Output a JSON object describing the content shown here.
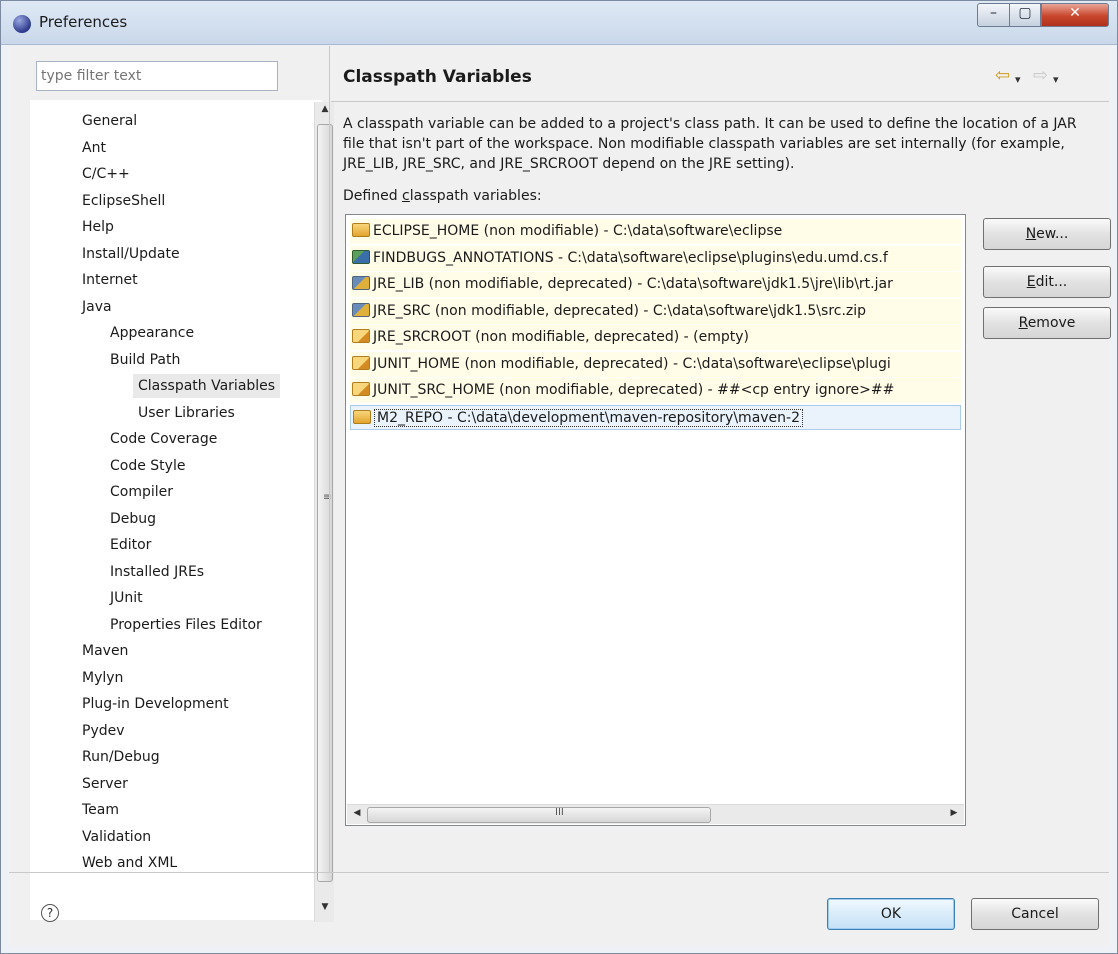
{
  "window": {
    "title": "Preferences",
    "controls": {
      "minimize": "–",
      "maximize": "▢",
      "close": "✕"
    }
  },
  "sidebar": {
    "filter_placeholder": "type filter text",
    "items": [
      {
        "label": "General",
        "level": 0
      },
      {
        "label": "Ant",
        "level": 0
      },
      {
        "label": "C/C++",
        "level": 0
      },
      {
        "label": "EclipseShell",
        "level": 0
      },
      {
        "label": "Help",
        "level": 0
      },
      {
        "label": "Install/Update",
        "level": 0
      },
      {
        "label": "Internet",
        "level": 0
      },
      {
        "label": "Java",
        "level": 0
      },
      {
        "label": "Appearance",
        "level": 1
      },
      {
        "label": "Build Path",
        "level": 1
      },
      {
        "label": "Classpath Variables",
        "level": 2,
        "selected": true
      },
      {
        "label": "User Libraries",
        "level": 2
      },
      {
        "label": "Code Coverage",
        "level": 1
      },
      {
        "label": "Code Style",
        "level": 1
      },
      {
        "label": "Compiler",
        "level": 1
      },
      {
        "label": "Debug",
        "level": 1
      },
      {
        "label": "Editor",
        "level": 1
      },
      {
        "label": "Installed JREs",
        "level": 1
      },
      {
        "label": "JUnit",
        "level": 1
      },
      {
        "label": "Properties Files Editor",
        "level": 1
      },
      {
        "label": "Maven",
        "level": 0
      },
      {
        "label": "Mylyn",
        "level": 0
      },
      {
        "label": "Plug-in Development",
        "level": 0
      },
      {
        "label": "Pydev",
        "level": 0
      },
      {
        "label": "Run/Debug",
        "level": 0
      },
      {
        "label": "Server",
        "level": 0
      },
      {
        "label": "Team",
        "level": 0
      },
      {
        "label": "Validation",
        "level": 0
      },
      {
        "label": "Web and XML",
        "level": 0
      }
    ]
  },
  "main": {
    "title": "Classpath Variables",
    "description": "A classpath variable can be added to a project's class path. It can be used to define the location of a JAR file that isn't part of the workspace. Non modifiable classpath variables are set internally (for example, JRE_LIB, JRE_SRC, and JRE_SRCROOT depend on the JRE setting).",
    "defined_label_pre": "Defined ",
    "defined_label_mnemonic": "c",
    "defined_label_post": "lasspath variables:",
    "variables": [
      {
        "text": "ECLIPSE_HOME (non modifiable) - C:\\data\\software\\eclipse",
        "icon": "folder-icon"
      },
      {
        "text": "FINDBUGS_ANNOTATIONS - C:\\data\\software\\eclipse\\plugins\\edu.umd.cs.f",
        "icon": "jar-icon"
      },
      {
        "text": "JRE_LIB (non modifiable, deprecated) - C:\\data\\software\\jdk1.5\\jre\\lib\\rt.jar",
        "icon": "deprecated-jar-icon"
      },
      {
        "text": "JRE_SRC (non modifiable, deprecated) - C:\\data\\software\\jdk1.5\\src.zip",
        "icon": "deprecated-jar-icon"
      },
      {
        "text": "JRE_SRCROOT (non modifiable, deprecated) - (empty)",
        "icon": "deprecated-folder-icon"
      },
      {
        "text": "JUNIT_HOME (non modifiable, deprecated) - C:\\data\\software\\eclipse\\plugi",
        "icon": "deprecated-folder-icon"
      },
      {
        "text": "JUNIT_SRC_HOME (non modifiable, deprecated) - ##<cp entry ignore>##",
        "icon": "deprecated-folder-icon"
      },
      {
        "text": "M2_REPO - C:\\data\\development\\maven-repository\\maven-2",
        "icon": "folder-icon",
        "selected": true
      }
    ],
    "buttons": {
      "new_mnemonic": "N",
      "new_rest": "ew...",
      "edit_mnemonic": "E",
      "edit_rest": "dit...",
      "remove_mnemonic": "R",
      "remove_rest": "emove"
    },
    "scroll_grip": "III"
  },
  "footer": {
    "help_glyph": "?",
    "ok_label": "OK",
    "cancel_label": "Cancel"
  },
  "nav": {
    "back_glyph": "⇦",
    "forward_glyph": "⇨",
    "dropdown_glyph": "▾"
  }
}
